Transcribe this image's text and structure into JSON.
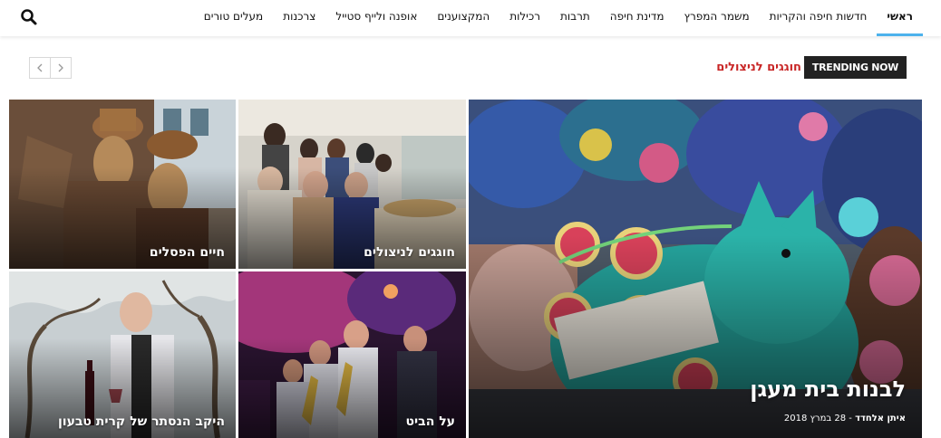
{
  "nav": {
    "items": [
      {
        "label": "ראשי"
      },
      {
        "label": "חדשות חיפה והקריות"
      },
      {
        "label": "משמר המפרץ"
      },
      {
        "label": "מדינת חיפה"
      },
      {
        "label": "תרבות"
      },
      {
        "label": "רכילות"
      },
      {
        "label": "המקצוענים"
      },
      {
        "label": "אופנה ולייף סטייל"
      },
      {
        "label": "צרכנות"
      },
      {
        "label": "מעלים טורים"
      }
    ],
    "search_icon": "search-icon"
  },
  "trending": {
    "badge": "TRENDING NOW",
    "headline": "חוגגים לניצולים",
    "prev_icon": "chevron-left-icon",
    "next_icon": "chevron-right-icon"
  },
  "featured": {
    "main": {
      "title": "לבנות בית מעגן",
      "author": "איתן אלחדד",
      "separator": "-",
      "date": "28 במרץ 2018"
    },
    "tiles": [
      {
        "title": "חוגגים לניצולים"
      },
      {
        "title": "חיים הפסלים"
      },
      {
        "title": "על הביט"
      },
      {
        "title": "היקב הנסתר של קרית טבעון"
      }
    ]
  },
  "colors": {
    "accent": "#4db2ec",
    "trending_red": "#c82525",
    "badge_bg": "#222222"
  }
}
